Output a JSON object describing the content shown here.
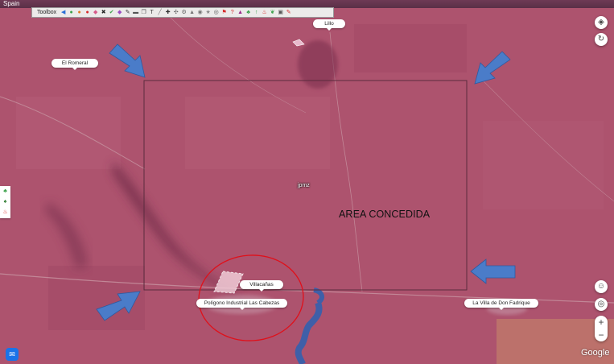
{
  "window": {
    "title": "Spain"
  },
  "toolbox": {
    "label": "Toolbox",
    "tools": [
      {
        "icon": "back-arrow-icon",
        "glyph": "◀",
        "color": "#2a6fd6"
      },
      {
        "icon": "globe-icon",
        "glyph": "●",
        "color": "#3aa14a"
      },
      {
        "icon": "circle-icon",
        "glyph": "●",
        "color": "#e07b1f"
      },
      {
        "icon": "marker-icon",
        "glyph": "●",
        "color": "#d62a2a"
      },
      {
        "icon": "pin-icon",
        "glyph": "◆",
        "color": "#d65a8a"
      },
      {
        "icon": "tools-icon",
        "glyph": "✖",
        "color": "#222222"
      },
      {
        "icon": "check-icon",
        "glyph": "✔",
        "color": "#3aa14a"
      },
      {
        "icon": "tag-icon",
        "glyph": "◆",
        "color": "#9a4fc2"
      },
      {
        "icon": "pen-icon",
        "glyph": "✎",
        "color": "#333333"
      },
      {
        "icon": "ruler-icon",
        "glyph": "▬",
        "color": "#555555"
      },
      {
        "icon": "copy-icon",
        "glyph": "❐",
        "color": "#555555"
      },
      {
        "icon": "text-icon",
        "glyph": "T",
        "color": "#333333"
      },
      {
        "icon": "line-icon",
        "glyph": "╱",
        "color": "#777777"
      },
      {
        "icon": "crosshair-icon",
        "glyph": "✚",
        "color": "#333333"
      },
      {
        "icon": "compass-icon",
        "glyph": "✣",
        "color": "#666666"
      },
      {
        "icon": "gear-icon",
        "glyph": "⚙",
        "color": "#666666"
      },
      {
        "icon": "building-icon",
        "glyph": "▲",
        "color": "#777777"
      },
      {
        "icon": "camera-icon",
        "glyph": "◉",
        "color": "#777777"
      },
      {
        "icon": "star-icon",
        "glyph": "★",
        "color": "#888888"
      },
      {
        "icon": "eye-icon",
        "glyph": "◎",
        "color": "#555555"
      },
      {
        "icon": "flag-icon",
        "glyph": "⚑",
        "color": "#d62a2a"
      },
      {
        "icon": "question-icon",
        "glyph": "?",
        "color": "#d62a2a"
      },
      {
        "icon": "warning-icon",
        "glyph": "▲",
        "color": "#9a2a8a"
      },
      {
        "icon": "tree-icon",
        "glyph": "♣",
        "color": "#3aa14a"
      },
      {
        "icon": "up-arrow-icon",
        "glyph": "↑",
        "color": "#3aa14a"
      },
      {
        "icon": "fire-icon",
        "glyph": "♨",
        "color": "#d62a2a"
      },
      {
        "icon": "leaf-icon",
        "glyph": "❦",
        "color": "#3aa14a"
      },
      {
        "icon": "monitor-icon",
        "glyph": "▣",
        "color": "#555555"
      },
      {
        "icon": "edit-icon",
        "glyph": "✎",
        "color": "#d62a2a"
      }
    ]
  },
  "places": [
    {
      "id": "lillo",
      "label": "Lillo"
    },
    {
      "id": "el-romeral",
      "label": "El Romeral"
    },
    {
      "id": "villacanas",
      "label": "Villacañas"
    },
    {
      "id": "poligono",
      "label": "Polígono Industrial Las Cabezas"
    },
    {
      "id": "villa-don-fadrique",
      "label": "La Villa de Don Fadrique"
    }
  ],
  "annotations": {
    "area_label": "AREA CONCEDIDA",
    "polygon_label": "jpmz"
  },
  "controls": {
    "layers_icon": "layers-icon",
    "refresh_icon": "refresh-icon",
    "street_view_icon": "pegman-icon",
    "locate_icon": "locate-icon",
    "zoom_in": "+",
    "zoom_out": "−",
    "attribution": "Google",
    "chat_icon": "chat-icon"
  },
  "colors": {
    "overlay": "#a94f6a",
    "arrow": "#4a7cc9",
    "highlight_circle": "#e0101a",
    "rectangle_border": "#5a2b3d",
    "river": "#3f5fa8"
  }
}
